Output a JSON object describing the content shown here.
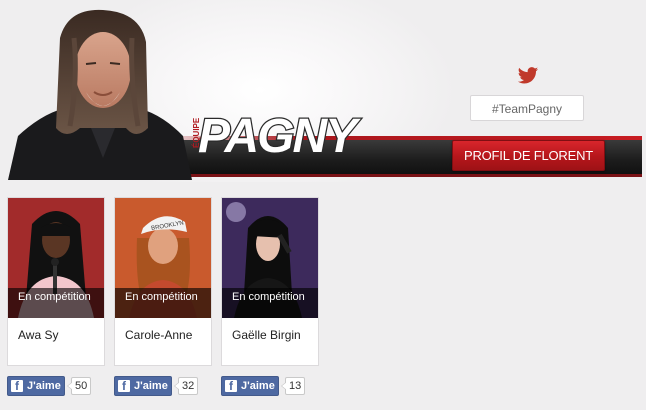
{
  "header": {
    "team_prefix": "ÉQUIPE",
    "team_name": "PAGNY",
    "hashtag": "#TeamPagny",
    "profile_button": "PROFIL DE FLORENT",
    "twitter_icon": "twitter-bird-icon"
  },
  "colors": {
    "accent_red": "#c81c22",
    "facebook_blue": "#4e69a2",
    "twitter_blue": "#55acee"
  },
  "contestants": [
    {
      "status": "En compétition",
      "name": "Awa Sy",
      "likes": "50"
    },
    {
      "status": "En compétition",
      "name": "Carole-Anne",
      "likes": "32"
    },
    {
      "status": "En compétition",
      "name": "Gaëlle Birgin",
      "likes": "13"
    }
  ],
  "like_label": "J'aime"
}
